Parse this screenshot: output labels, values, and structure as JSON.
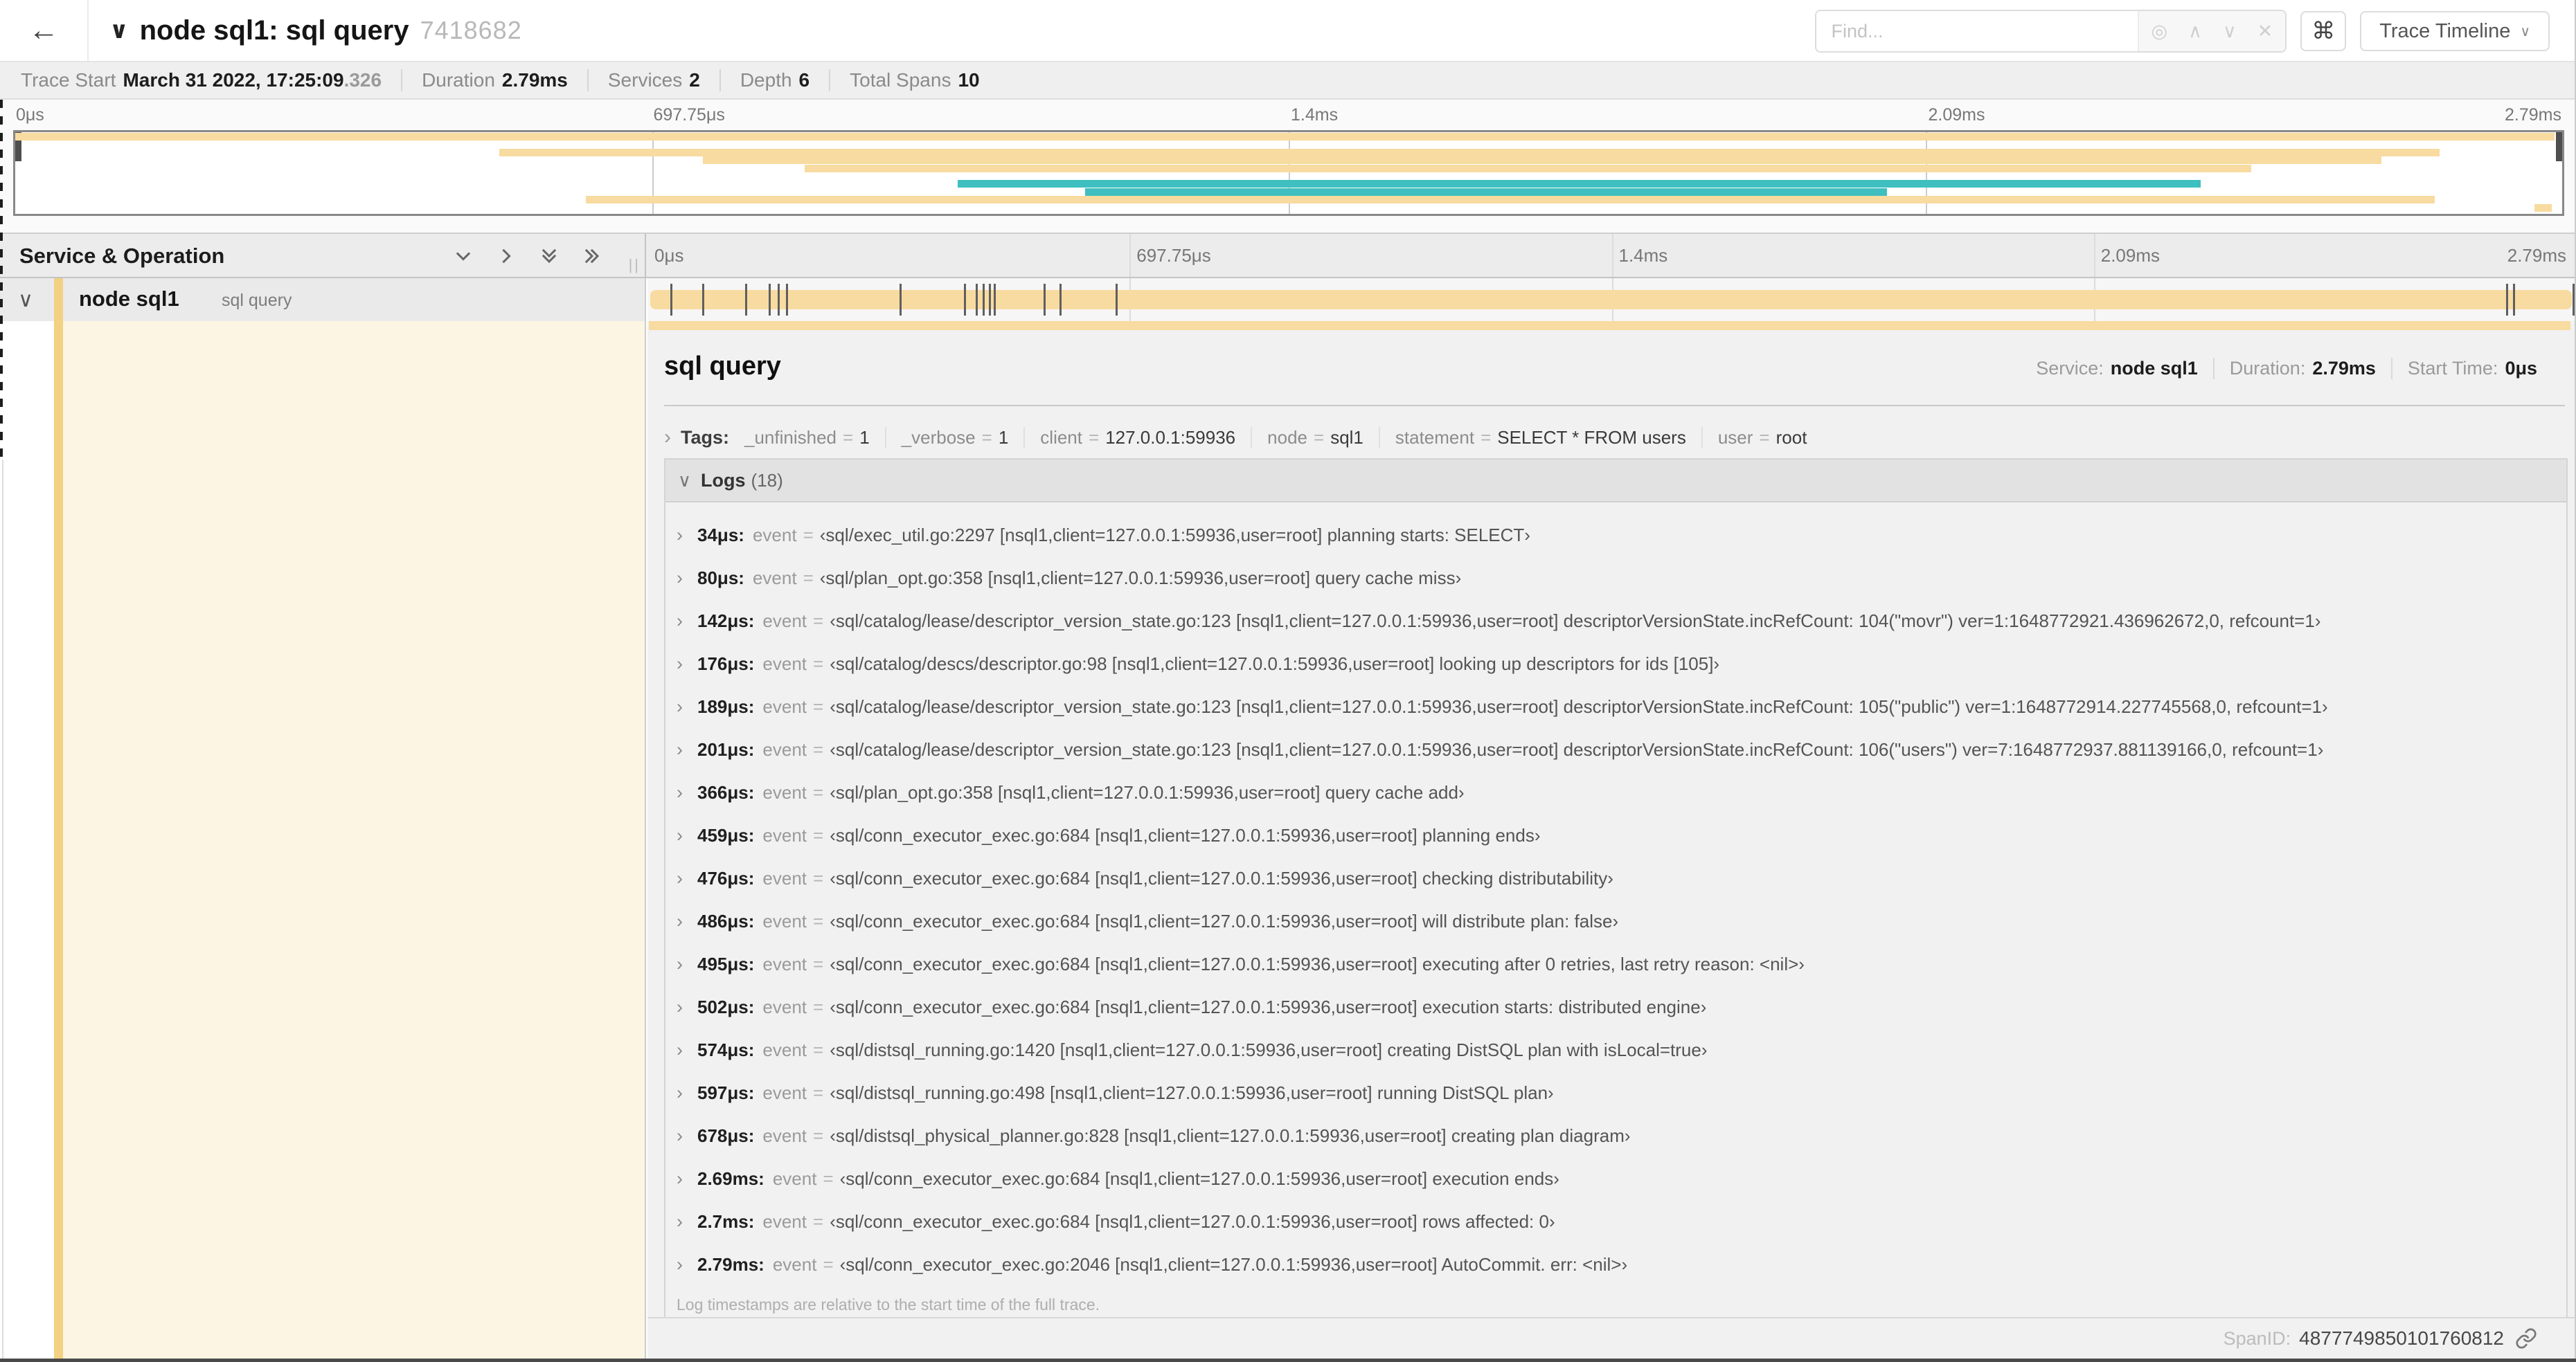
{
  "header": {
    "back_icon": "←",
    "collapse_icon": "∨",
    "title": "node sql1: sql query",
    "trace_id": "7418682",
    "find_placeholder": "Find...",
    "target_icon": "◎",
    "prev_icon": "∧",
    "next_icon": "∨",
    "clear_icon": "✕",
    "command_icon": "⌘",
    "view_button": "Trace Timeline",
    "view_chevron": "∨"
  },
  "statsbar": {
    "items": [
      {
        "label": "Trace Start",
        "value": "March 31 2022, 17:25:09",
        "suffix": ".326"
      },
      {
        "label": "Duration",
        "value": "2.79ms",
        "suffix": ""
      },
      {
        "label": "Services",
        "value": "2",
        "suffix": ""
      },
      {
        "label": "Depth",
        "value": "6",
        "suffix": ""
      },
      {
        "label": "Total Spans",
        "value": "10",
        "suffix": ""
      }
    ]
  },
  "time_ticks": [
    "0μs",
    "697.75μs",
    "1.4ms",
    "2.09ms",
    "2.79ms"
  ],
  "total_us": 2790,
  "colors": {
    "tan": "#f8dba0",
    "teal": "#3fbfbf",
    "accent_tan": "#f3d183",
    "cream": "#fcf5e3"
  },
  "minimap": {
    "spans": [
      {
        "slot": 0,
        "start": 0,
        "end": 99.7,
        "color": "tan"
      },
      {
        "slot": 2,
        "start": 19,
        "end": 95.2,
        "color": "tan"
      },
      {
        "slot": 3,
        "start": 27,
        "end": 92.9,
        "color": "tan"
      },
      {
        "slot": 4,
        "start": 31,
        "end": 87.8,
        "color": "tan"
      },
      {
        "slot": 6,
        "start": 37,
        "end": 85.8,
        "color": "teal"
      },
      {
        "slot": 7,
        "start": 42,
        "end": 73.5,
        "color": "teal"
      },
      {
        "slot": 8,
        "start": 22.4,
        "end": 95,
        "color": "tan"
      },
      {
        "slot": 9,
        "start": 98.9,
        "end": 99.6,
        "color": "tan"
      }
    ]
  },
  "timeline": {
    "left_header": "Service & Operation",
    "grip": "||",
    "row": {
      "chevron": "∨",
      "service": "node sql1",
      "operation": "sql query"
    }
  },
  "detail": {
    "operation": "sql query",
    "meta": [
      {
        "label": "Service:",
        "value": "node sql1"
      },
      {
        "label": "Duration:",
        "value": "2.79ms"
      },
      {
        "label": "Start Time:",
        "value": "0μs"
      }
    ],
    "tags_chevron": "›",
    "tags_label": "Tags:",
    "tags": [
      {
        "key": "_unfinished",
        "value": "1"
      },
      {
        "key": "_verbose",
        "value": "1"
      },
      {
        "key": "client",
        "value": "127.0.0.1:59936"
      },
      {
        "key": "node",
        "value": "sql1"
      },
      {
        "key": "statement",
        "value": "SELECT * FROM users"
      },
      {
        "key": "user",
        "value": "root"
      }
    ],
    "logs": {
      "chevron": "∨",
      "label": "Logs",
      "count": "(18)",
      "rows": [
        {
          "t": 34,
          "time": "34μs:",
          "key": "event",
          "value": "‹sql/exec_util.go:2297 [nsql1,client=127.0.0.1:59936,user=root] planning starts: SELECT›"
        },
        {
          "t": 80,
          "time": "80μs:",
          "key": "event",
          "value": "‹sql/plan_opt.go:358 [nsql1,client=127.0.0.1:59936,user=root] query cache miss›"
        },
        {
          "t": 142,
          "time": "142μs:",
          "key": "event",
          "value": "‹sql/catalog/lease/descriptor_version_state.go:123 [nsql1,client=127.0.0.1:59936,user=root] descriptorVersionState.incRefCount: 104(\"movr\") ver=1:1648772921.436962672,0, refcount=1›"
        },
        {
          "t": 176,
          "time": "176μs:",
          "key": "event",
          "value": "‹sql/catalog/descs/descriptor.go:98 [nsql1,client=127.0.0.1:59936,user=root] looking up descriptors for ids [105]›"
        },
        {
          "t": 189,
          "time": "189μs:",
          "key": "event",
          "value": "‹sql/catalog/lease/descriptor_version_state.go:123 [nsql1,client=127.0.0.1:59936,user=root] descriptorVersionState.incRefCount: 105(\"public\") ver=1:1648772914.227745568,0, refcount=1›"
        },
        {
          "t": 201,
          "time": "201μs:",
          "key": "event",
          "value": "‹sql/catalog/lease/descriptor_version_state.go:123 [nsql1,client=127.0.0.1:59936,user=root] descriptorVersionState.incRefCount: 106(\"users\") ver=7:1648772937.881139166,0, refcount=1›"
        },
        {
          "t": 366,
          "time": "366μs:",
          "key": "event",
          "value": "‹sql/plan_opt.go:358 [nsql1,client=127.0.0.1:59936,user=root] query cache add›"
        },
        {
          "t": 459,
          "time": "459μs:",
          "key": "event",
          "value": "‹sql/conn_executor_exec.go:684 [nsql1,client=127.0.0.1:59936,user=root] planning ends›"
        },
        {
          "t": 476,
          "time": "476μs:",
          "key": "event",
          "value": "‹sql/conn_executor_exec.go:684 [nsql1,client=127.0.0.1:59936,user=root] checking distributability›"
        },
        {
          "t": 486,
          "time": "486μs:",
          "key": "event",
          "value": "‹sql/conn_executor_exec.go:684 [nsql1,client=127.0.0.1:59936,user=root] will distribute plan: false›"
        },
        {
          "t": 495,
          "time": "495μs:",
          "key": "event",
          "value": "‹sql/conn_executor_exec.go:684 [nsql1,client=127.0.0.1:59936,user=root] executing after 0 retries, last retry reason: <nil>›"
        },
        {
          "t": 502,
          "time": "502μs:",
          "key": "event",
          "value": "‹sql/conn_executor_exec.go:684 [nsql1,client=127.0.0.1:59936,user=root] execution starts: distributed engine›"
        },
        {
          "t": 574,
          "time": "574μs:",
          "key": "event",
          "value": "‹sql/distsql_running.go:1420 [nsql1,client=127.0.0.1:59936,user=root] creating DistSQL plan with isLocal=true›"
        },
        {
          "t": 597,
          "time": "597μs:",
          "key": "event",
          "value": "‹sql/distsql_running.go:498 [nsql1,client=127.0.0.1:59936,user=root] running DistSQL plan›"
        },
        {
          "t": 678,
          "time": "678μs:",
          "key": "event",
          "value": "‹sql/distsql_physical_planner.go:828 [nsql1,client=127.0.0.1:59936,user=root] creating plan diagram›"
        },
        {
          "t": 2690,
          "time": "2.69ms:",
          "key": "event",
          "value": "‹sql/conn_executor_exec.go:684 [nsql1,client=127.0.0.1:59936,user=root] execution ends›"
        },
        {
          "t": 2700,
          "time": "2.7ms:",
          "key": "event",
          "value": "‹sql/conn_executor_exec.go:684 [nsql1,client=127.0.0.1:59936,user=root] rows affected: 0›"
        },
        {
          "t": 2790,
          "time": "2.79ms:",
          "key": "event",
          "value": "‹sql/conn_executor_exec.go:2046 [nsql1,client=127.0.0.1:59936,user=root] AutoCommit. err: <nil>›"
        }
      ],
      "footer": "Log timestamps are relative to the start time of the full trace."
    },
    "span_id_label": "SpanID:",
    "span_id": "4877749850101760812"
  }
}
